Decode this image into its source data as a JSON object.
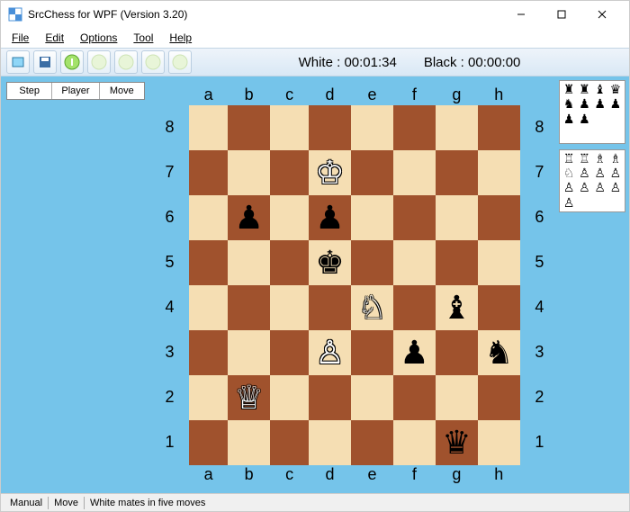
{
  "window": {
    "title": "SrcChess for WPF (Version 3.20)"
  },
  "menu": [
    "File",
    "Edit",
    "Options",
    "Tool",
    "Help"
  ],
  "clock": {
    "white_label": "White :",
    "white_time": "00:01:34",
    "black_label": "Black :",
    "black_time": "00:00:00"
  },
  "move_headers": [
    "Step",
    "Player",
    "Move"
  ],
  "files": [
    "a",
    "b",
    "c",
    "d",
    "e",
    "f",
    "g",
    "h"
  ],
  "ranks": [
    "8",
    "7",
    "6",
    "5",
    "4",
    "3",
    "2",
    "1"
  ],
  "pieces": {
    "d7": {
      "g": "♔",
      "c": "w"
    },
    "b6": {
      "g": "♟",
      "c": "b"
    },
    "d6": {
      "g": "♟",
      "c": "b"
    },
    "d5": {
      "g": "♚",
      "c": "b"
    },
    "e4": {
      "g": "♘",
      "c": "w"
    },
    "g4": {
      "g": "♝",
      "c": "b"
    },
    "d3": {
      "g": "♙",
      "c": "w"
    },
    "f3": {
      "g": "♟",
      "c": "b"
    },
    "h3": {
      "g": "♞",
      "c": "b"
    },
    "b2": {
      "g": "♕",
      "c": "w"
    },
    "g1": {
      "g": "♛",
      "c": "b"
    }
  },
  "captured_black": [
    "♜",
    "♜",
    "♝",
    "♛",
    "♞",
    "♟",
    "♟",
    "♟",
    "♟",
    "♟"
  ],
  "captured_white": [
    "♖",
    "♖",
    "♗",
    "♗",
    "♘",
    "♙",
    "♙",
    "♙",
    "♙",
    "♙",
    "♙",
    "♙",
    "♙"
  ],
  "status": {
    "mode": "Manual",
    "turn": "Move",
    "msg": "White mates in five moves"
  }
}
